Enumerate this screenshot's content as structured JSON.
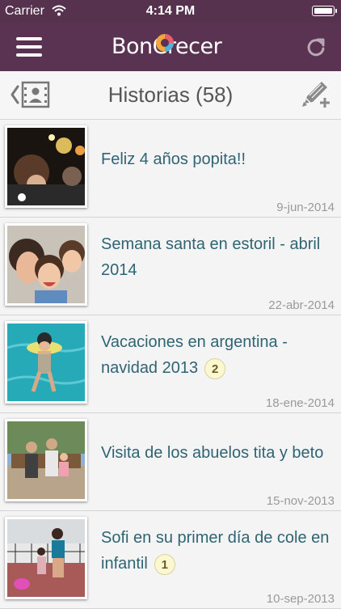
{
  "status_bar": {
    "carrier": "Carrier",
    "time": "4:14 PM"
  },
  "nav": {
    "logo_text": "BonCrecer",
    "menu_icon": "hamburger-icon",
    "refresh_icon": "refresh-icon"
  },
  "header": {
    "title": "Historias (58)",
    "back_icon": "back-contact-icon",
    "edit_icon": "pencil-add-icon"
  },
  "colors": {
    "nav_bg": "#5b3352",
    "title_text": "#2f6474",
    "date_text": "#9a9a9a"
  },
  "stories": [
    {
      "title": "Feliz 4 años popita!!",
      "date": "9-jun-2014",
      "badge": ""
    },
    {
      "title": "Semana santa en estoril - abril 2014",
      "date": "22-abr-2014",
      "badge": ""
    },
    {
      "title": "Vacaciones en argentina - navidad 2013",
      "date": "18-ene-2014",
      "badge": "2"
    },
    {
      "title": "Visita de los abuelos tita y beto",
      "date": "15-nov-2013",
      "badge": ""
    },
    {
      "title": "Sofi en su primer día de cole en infantil",
      "date": "10-sep-2013",
      "badge": "1"
    }
  ]
}
